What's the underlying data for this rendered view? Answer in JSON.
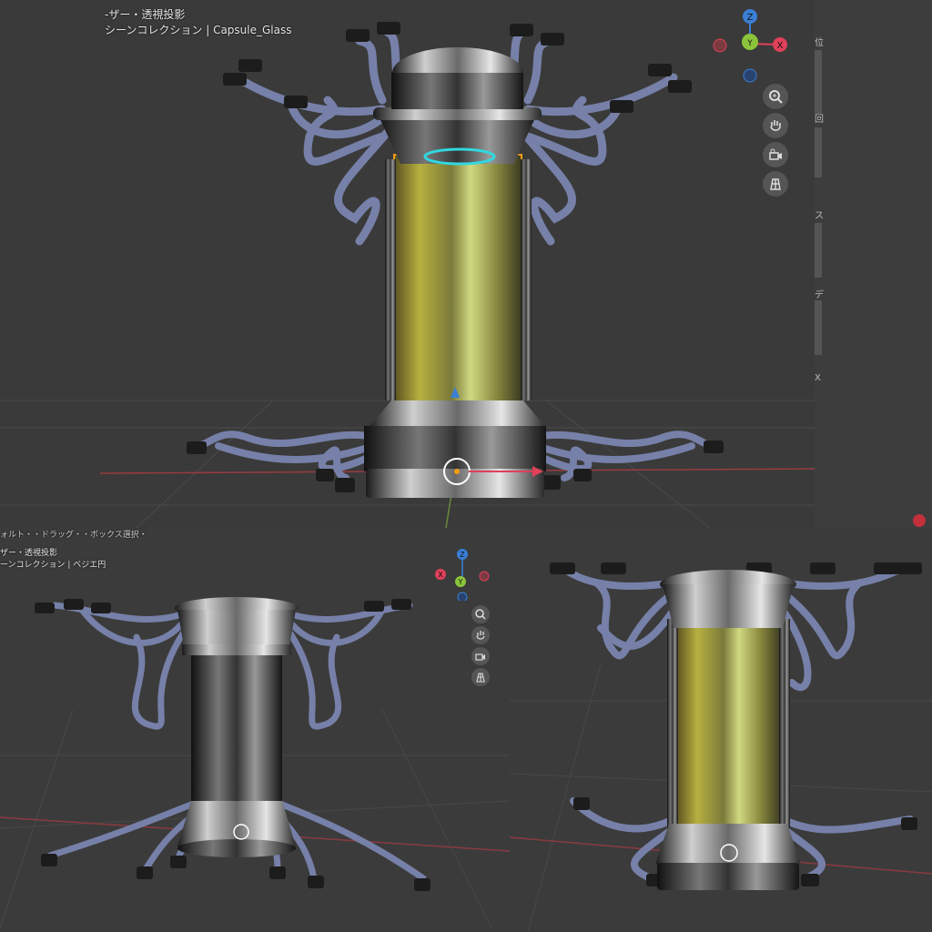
{
  "top_view": {
    "view_label": "-ザー・透視投影",
    "collection_label": "シーンコレクション | Capsule_Glass",
    "gizmo": {
      "z": "Z",
      "x": "X",
      "y": "Y"
    },
    "tools": [
      "zoom-icon",
      "hand-icon",
      "camera-icon",
      "grid-icon"
    ]
  },
  "bottom_left_view": {
    "header_text": "ォルト・・ドラッグ・・ボックス選択・",
    "view_label": "ザー・透視投影",
    "collection_label": "ーンコレクション | ベジエ円",
    "gizmo": {
      "z": "Z",
      "x": "X",
      "y": "Y"
    },
    "tools": [
      "zoom-icon",
      "hand-icon",
      "camera-icon",
      "grid-icon"
    ]
  },
  "side_panel_marks": [
    "位",
    "回",
    "ス",
    "デ",
    "X"
  ],
  "colors": {
    "viewport_bg": "#3d3d3d",
    "x_axis": "#e0405a",
    "y_axis": "#8bc43a",
    "z_axis": "#3a7fd6",
    "selection": "#f39c12",
    "cable": "#7680a8"
  }
}
